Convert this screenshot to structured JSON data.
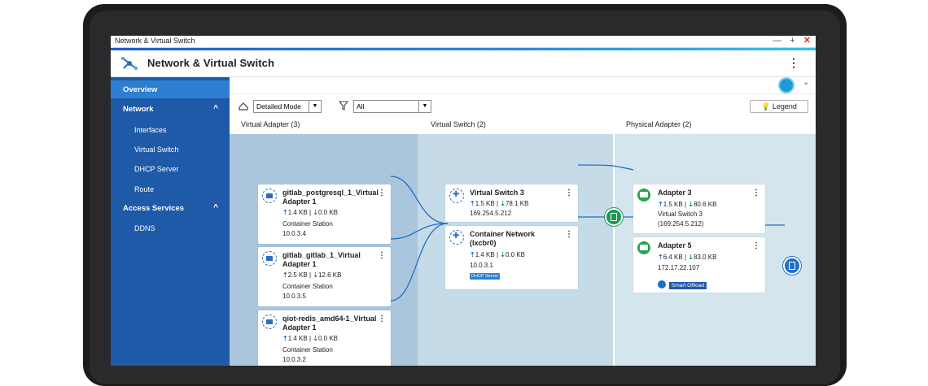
{
  "window": {
    "title": "Network & Virtual Switch",
    "controls": [
      "—",
      "+",
      "✕"
    ]
  },
  "app": {
    "title": "Network & Virtual Switch",
    "menu_glyph": "⋮"
  },
  "sidebar": {
    "items": [
      {
        "label": "Overview",
        "type": "item",
        "active": true
      },
      {
        "label": "Network",
        "type": "section",
        "chevron": "^"
      },
      {
        "label": "Interfaces",
        "type": "sub"
      },
      {
        "label": "Virtual Switch",
        "type": "sub"
      },
      {
        "label": "DHCP Server",
        "type": "sub"
      },
      {
        "label": "Route",
        "type": "sub"
      },
      {
        "label": "Access Services",
        "type": "section",
        "chevron": "^"
      },
      {
        "label": "DDNS",
        "type": "sub"
      }
    ]
  },
  "toolbar": {
    "mode_value": "Detailed Mode",
    "filter_value": "All",
    "legend_label": "Legend",
    "dropdown_glyph": "▼"
  },
  "columns": {
    "virtual_adapter": "Virtual Adapter (3)",
    "virtual_switch": "Virtual Switch (2)",
    "physical_adapter": "Physical Adapter (2)"
  },
  "virtual_adapters": [
    {
      "name": "gitlab_postgresql_1_Virtual Adapter 1",
      "up": "1.4 KB",
      "down": "0.0 KB",
      "host": "Container Station",
      "ip": "10.0.3.4"
    },
    {
      "name": "gitlab_gitlab_1_Virtual Adapter 1",
      "up": "2.5 KB",
      "down": "12.6 KB",
      "host": "Container Station",
      "ip": "10.0.3.5"
    },
    {
      "name": "qiot-redis_amd64-1_Virtual Adapter 1",
      "up": "1.4 KB",
      "down": "0.0 KB",
      "host": "Container Station",
      "ip": "10.0.3.2"
    }
  ],
  "virtual_switches": [
    {
      "name": "Virtual Switch 3",
      "up": "1.5 KB",
      "down": "78.1 KB",
      "ip": "169.254.5.212"
    },
    {
      "name": "Container Network (lxcbr0)",
      "up": "1.4 KB",
      "down": "0.0 KB",
      "ip": "10.0.3.1",
      "tag": "DHCP Server"
    }
  ],
  "physical_adapters": [
    {
      "name": "Adapter 3",
      "badge": "1G",
      "up": "1.5 KB",
      "down": "80.6 KB",
      "switch": "Virtual Switch 3",
      "ip": "(169.254.5.212)"
    },
    {
      "name": "Adapter 5",
      "badge": "10G",
      "up": "6.4 KB",
      "down": "83.0 KB",
      "ip": "172.17.22.107",
      "tag": "Smart Offload"
    }
  ],
  "glyphs": {
    "up": "⇡",
    "down": "⇣",
    "sep": "|",
    "kebab": "⋮"
  },
  "colors": {
    "sidebar": "#1f5aa8",
    "sidebar_active": "#2d7fd3",
    "link": "#1f6fc7",
    "green": "#1e9a4a"
  }
}
